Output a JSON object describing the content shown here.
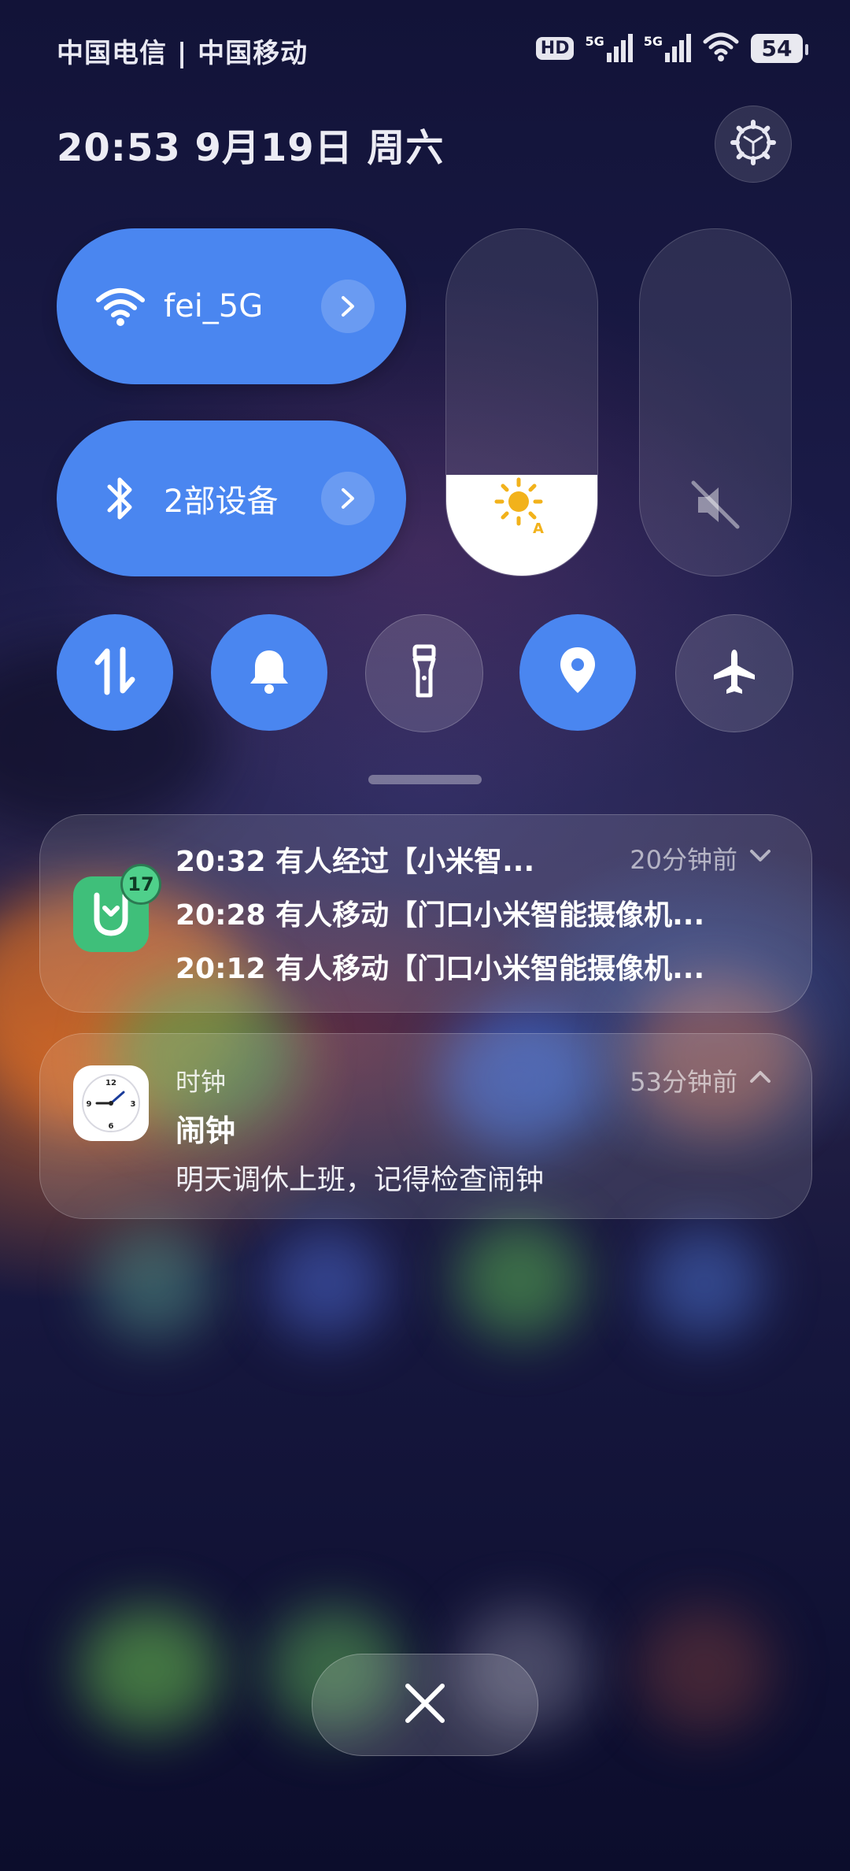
{
  "status_bar": {
    "carriers": "中国电信 | 中国移动",
    "hd_label": "HD",
    "signal_label_1": "5G",
    "signal_label_2": "5G",
    "battery": "54"
  },
  "header": {
    "datetime": "20:53 9月19日 周六",
    "settings_icon": "gear-icon"
  },
  "controls": {
    "wifi": {
      "label": "fei_5G",
      "icon": "wifi-icon",
      "active": true
    },
    "bluetooth": {
      "label": "2部设备",
      "icon": "bluetooth-icon",
      "active": true
    },
    "brightness": {
      "level": 0.29,
      "icon": "brightness-auto-icon"
    },
    "volume": {
      "level": 0.0,
      "icon": "mute-icon"
    },
    "toggles": [
      {
        "name": "mobile-data",
        "icon": "data-arrows-icon",
        "active": true
      },
      {
        "name": "bell",
        "icon": "bell-icon",
        "active": true
      },
      {
        "name": "flashlight",
        "icon": "flashlight-icon",
        "active": false
      },
      {
        "name": "location",
        "icon": "location-icon",
        "active": true
      },
      {
        "name": "airplane",
        "icon": "airplane-icon",
        "active": false
      }
    ],
    "accent_color": "#4a86f0"
  },
  "notifications": [
    {
      "app": "mijia",
      "badge": "17",
      "time_ago": "20分钟前",
      "lines": [
        "20:32 有人经过【小米智...",
        "20:28 有人移动【门口小米智能摄像机...",
        "20:12 有人移动【门口小米智能摄像机..."
      ]
    },
    {
      "app": "时钟",
      "time_ago": "53分钟前",
      "title": "闹钟",
      "body": "明天调休上班，记得检查闹钟"
    }
  ],
  "close_button_icon": "close-icon"
}
